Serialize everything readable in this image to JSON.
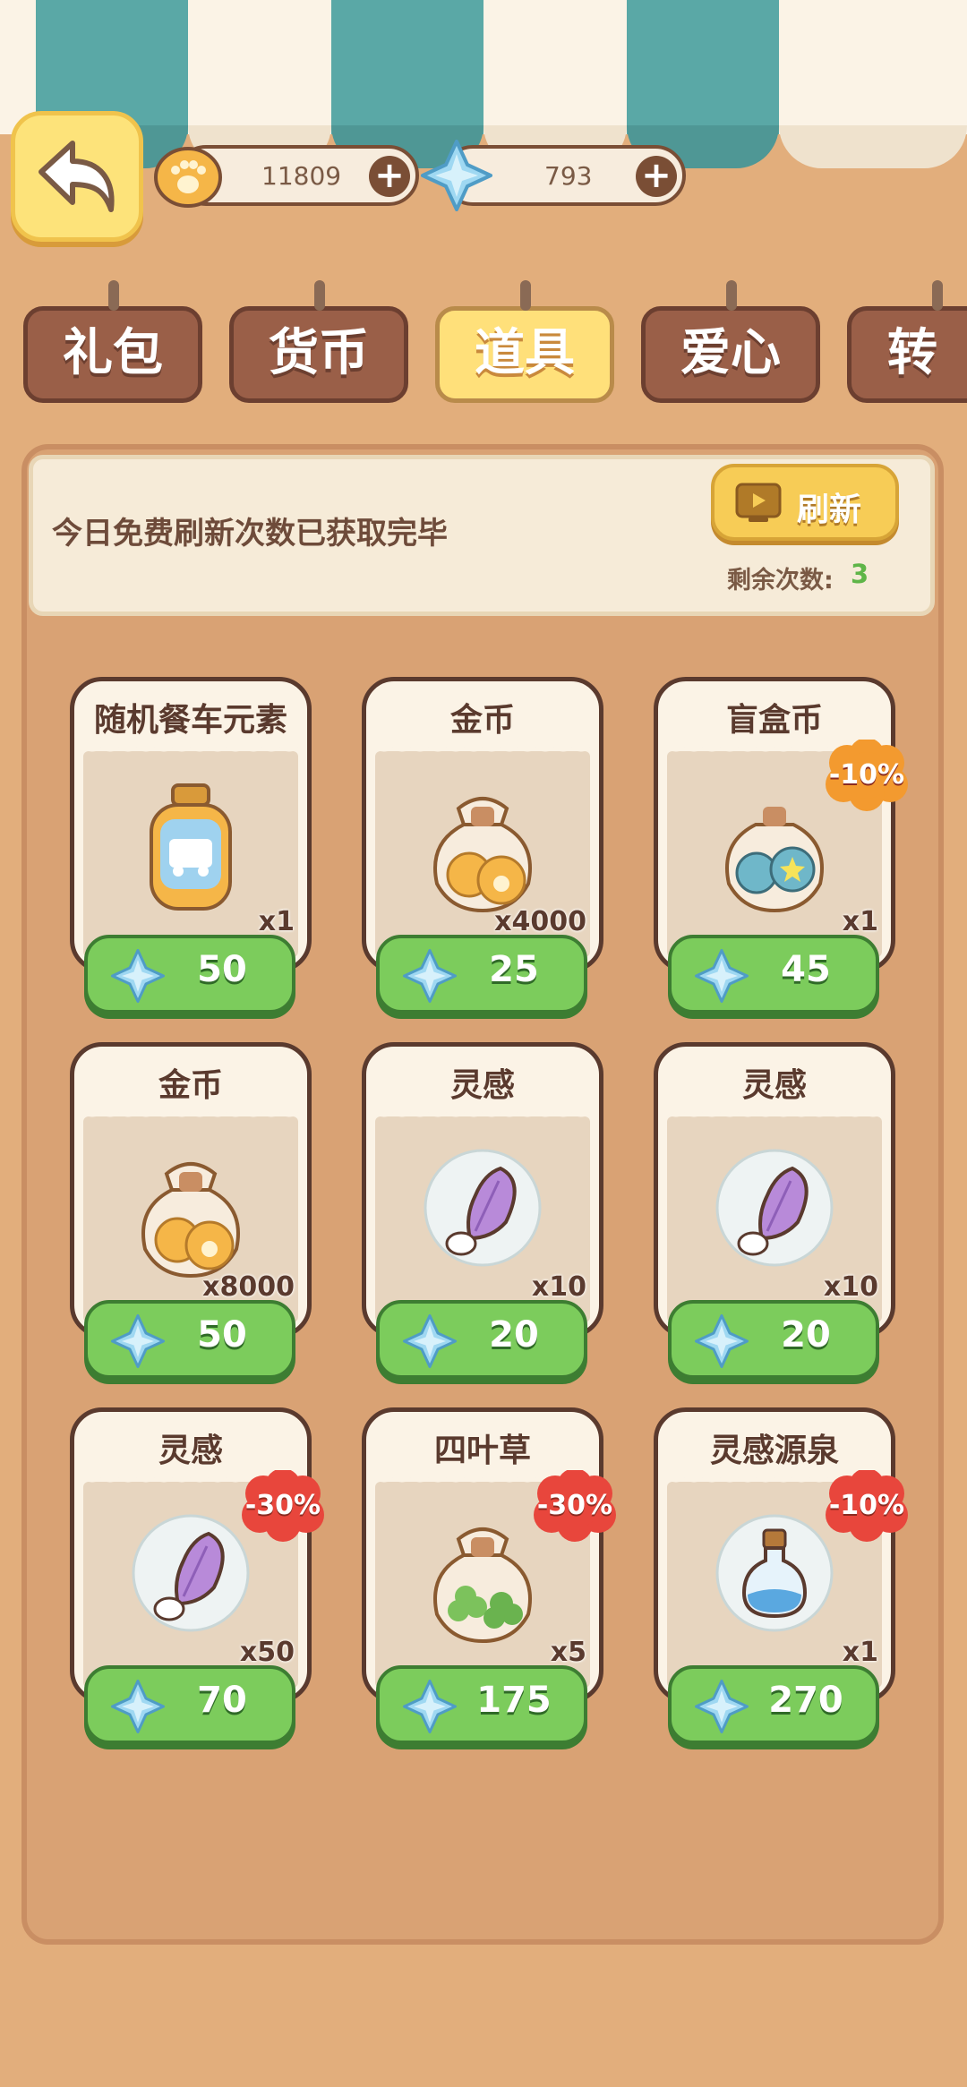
{
  "currency": {
    "coins": "11809",
    "gems": "793",
    "add": "+"
  },
  "tabs": [
    "礼包",
    "货币",
    "道具",
    "爱心",
    "转"
  ],
  "info": {
    "message": "今日免费刷新次数已获取完毕",
    "refresh_label": "刷新",
    "remaining_label": "剩余次数:",
    "remaining_count": "3"
  },
  "items": [
    {
      "name": "随机餐车元素",
      "qty": "x1",
      "price": "50",
      "discount": "",
      "icon": "food-truck-jar-icon"
    },
    {
      "name": "金币",
      "qty": "x4000",
      "price": "25",
      "discount": "",
      "icon": "coin-bag-icon"
    },
    {
      "name": "盲盒币",
      "qty": "x1",
      "price": "45",
      "discount": "-10%",
      "icon": "blindbox-coin-bag-icon"
    },
    {
      "name": "金币",
      "qty": "x8000",
      "price": "50",
      "discount": "",
      "icon": "coin-bag-icon"
    },
    {
      "name": "灵感",
      "qty": "x10",
      "price": "20",
      "discount": "",
      "icon": "inspiration-feather-icon"
    },
    {
      "name": "灵感",
      "qty": "x10",
      "price": "20",
      "discount": "",
      "icon": "inspiration-feather-icon"
    },
    {
      "name": "灵感",
      "qty": "x50",
      "price": "70",
      "discount": "-30%",
      "icon": "inspiration-feather-icon"
    },
    {
      "name": "四叶草",
      "qty": "x5",
      "price": "175",
      "discount": "-30%",
      "icon": "clover-bag-icon"
    },
    {
      "name": "灵感源泉",
      "qty": "x1",
      "price": "270",
      "discount": "-10%",
      "icon": "potion-bottle-icon"
    }
  ],
  "colors": {
    "accent_green": "#7ccc5c",
    "discount_red": "#e8463c",
    "discount_orange": "#f39a2f",
    "remaining_green": "#5fb548"
  }
}
